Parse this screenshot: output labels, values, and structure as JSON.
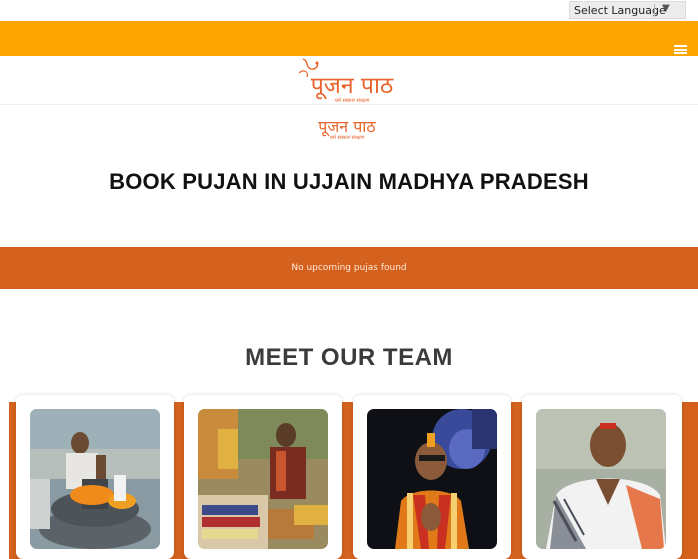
{
  "language_selector": {
    "label": "Select Language",
    "arrow": "▼"
  },
  "header": {
    "logo_text": "पूजन पाठ",
    "logo_tagline": "धर्म संस्कार संरक्षण"
  },
  "page_title": "BOOK PUJAN IN UJJAIN MADHYA PRADESH",
  "upcoming_pujas": {
    "empty_message": "No upcoming pujas found"
  },
  "team": {
    "heading": "MEET OUR TEAM",
    "members": [
      {
        "photo": "priest-performing-shivling-puja"
      },
      {
        "photo": "priest-reading-with-books"
      },
      {
        "photo": "priest-with-namaste-krishna-backdrop"
      },
      {
        "photo": "priest-in-printed-shawl"
      }
    ]
  },
  "colors": {
    "topbar": "#ffa500",
    "band": "#d4621e",
    "logo": "#e8632b"
  }
}
